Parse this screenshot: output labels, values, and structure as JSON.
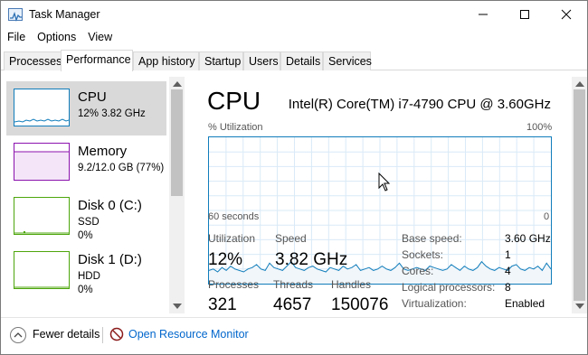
{
  "window": {
    "title": "Task Manager",
    "controls": [
      "minimize",
      "maximize",
      "close"
    ]
  },
  "menu": [
    "File",
    "Options",
    "View"
  ],
  "tabs": [
    {
      "label": "Processes",
      "active": false
    },
    {
      "label": "Performance",
      "active": true
    },
    {
      "label": "App history",
      "active": false
    },
    {
      "label": "Startup",
      "active": false
    },
    {
      "label": "Users",
      "active": false
    },
    {
      "label": "Details",
      "active": false
    },
    {
      "label": "Services",
      "active": false
    }
  ],
  "sidebar": {
    "items": [
      {
        "title": "CPU",
        "sub1": "12%  3.82 GHz",
        "sub2": "",
        "color": "#117dbb",
        "selected": true
      },
      {
        "title": "Memory",
        "sub1": "9.2/12.0 GB (77%)",
        "sub2": "",
        "color": "#8b12ae",
        "selected": false
      },
      {
        "title": "Disk 0 (C:)",
        "sub1": "SSD",
        "sub2": "0%",
        "color": "#4da60c",
        "selected": false
      },
      {
        "title": "Disk 1 (D:)",
        "sub1": "HDD",
        "sub2": "0%",
        "color": "#4da60c",
        "selected": false
      }
    ]
  },
  "cpu": {
    "title": "CPU",
    "model": "Intel(R) Core(TM) i7-4790 CPU @ 3.60GHz",
    "graph": {
      "ylabel": "% Utilization",
      "ymax_label": "100%",
      "xlabel_left": "60 seconds",
      "xlabel_right": "0",
      "utilization_percent": [
        9,
        10,
        8,
        11,
        9,
        12,
        10,
        9,
        8,
        10,
        11,
        13,
        10,
        9,
        14,
        11,
        10,
        9,
        12,
        15,
        11,
        10,
        9,
        11,
        12,
        10,
        9,
        8,
        11,
        10,
        9,
        12,
        10,
        11,
        13,
        9,
        10,
        11,
        9,
        10,
        12,
        10,
        9,
        11,
        14,
        10,
        9,
        10,
        11,
        10,
        9,
        12,
        11,
        10,
        9,
        10,
        13,
        11,
        9,
        12,
        10,
        9,
        11,
        15,
        12,
        10,
        9,
        11,
        10,
        9,
        12,
        13,
        10,
        9,
        11,
        10,
        12,
        9,
        14,
        10
      ],
      "line_color": "#117dbb"
    },
    "stats": {
      "utilization_label": "Utilization",
      "utilization_value": "12%",
      "speed_label": "Speed",
      "speed_value": "3.82 GHz",
      "processes_label": "Processes",
      "processes_value": "321",
      "threads_label": "Threads",
      "threads_value": "4657",
      "handles_label": "Handles",
      "handles_value": "150076"
    },
    "details": [
      {
        "label": "Base speed:",
        "value": "3.60 GHz"
      },
      {
        "label": "Sockets:",
        "value": "1"
      },
      {
        "label": "Cores:",
        "value": "4"
      },
      {
        "label": "Logical processors:",
        "value": "8"
      },
      {
        "label": "Virtualization:",
        "value": "Enabled"
      }
    ]
  },
  "footer": {
    "fewer_details": "Fewer details",
    "open_monitor": "Open Resource Monitor"
  }
}
